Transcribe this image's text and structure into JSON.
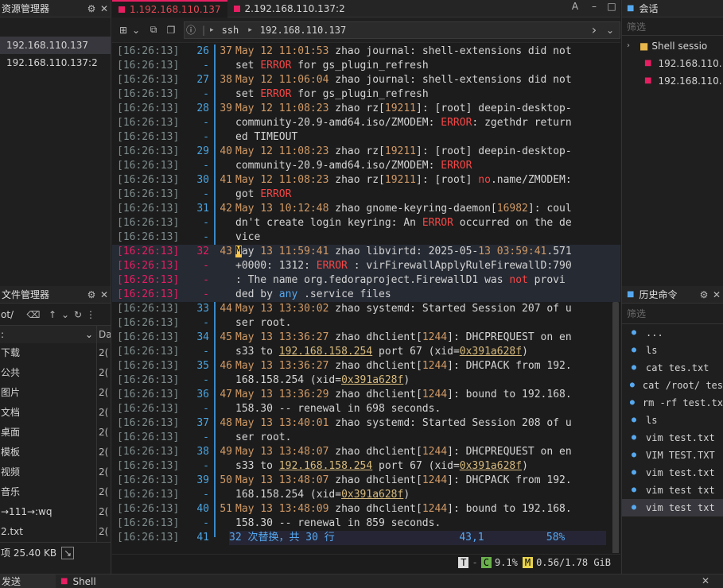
{
  "left": {
    "session_title": "资源管理器",
    "sessions": [
      "192.168.110.137",
      "192.168.110.137:2"
    ],
    "fm_title": "文件管理器",
    "fm_path": "ot/",
    "fm_col_date": "Da",
    "files": [
      {
        "name": "下载",
        "d": "2("
      },
      {
        "name": "公共",
        "d": "2("
      },
      {
        "name": "图片",
        "d": "2("
      },
      {
        "name": "文档",
        "d": "2("
      },
      {
        "name": "桌面",
        "d": "2("
      },
      {
        "name": "模板",
        "d": "2("
      },
      {
        "name": "视频",
        "d": "2("
      },
      {
        "name": "音乐",
        "d": "2("
      },
      {
        "name": "→111→:wq",
        "d": "2("
      },
      {
        "name": "2.txt",
        "d": "2("
      }
    ],
    "fm_status": "项 25.40 KB"
  },
  "tabs": [
    {
      "label": "1.192.168.110.137"
    },
    {
      "label": "2.192.168.110.137:2"
    }
  ],
  "tab_right": "A",
  "toolbar": {
    "path1": "ssh",
    "path2": "192.168.110.137"
  },
  "lines": [
    {
      "ts": "[16:26:13]",
      "ln": "26",
      "n": "37",
      "a": "May 12 11:01:53 zhao journal: shell-extensions did not",
      "b": "set ERROR for gs_plugin_refresh"
    },
    {
      "ts": "[16:26:13]",
      "ln": "27",
      "n": "38",
      "a": "May 12 11:06:04 zhao journal: shell-extensions did not",
      "b": "set ERROR for gs_plugin_refresh"
    },
    {
      "ts": "[16:26:13]",
      "ln": "28",
      "n": "39",
      "a": "May 12 11:08:23 zhao rz[19211]: [root] deepin-desktop-",
      "b": "community-20.9-amd64.iso/ZMODEM: ERROR: zgethdr return",
      "c": "ed TIMEOUT"
    },
    {
      "ts": "[16:26:13]",
      "ln": "29",
      "n": "40",
      "a": "May 12 11:08:23 zhao rz[19211]: [root] deepin-desktop-",
      "b": "community-20.9-amd64.iso/ZMODEM: ERROR"
    },
    {
      "ts": "[16:26:13]",
      "ln": "30",
      "n": "41",
      "a": "May 12 11:08:23 zhao rz[19211]: [root] no.name/ZMODEM:",
      "b": "got ERROR"
    },
    {
      "ts": "[16:26:13]",
      "ln": "31",
      "n": "42",
      "a": "May 13 10:12:48 zhao gnome-keyring-daemon[16982]: coul",
      "b": "dn't create login keyring: An ERROR occurred on the de",
      "c": "vice"
    },
    {
      "ts": "[16:26:13]",
      "ln": "32",
      "n": "43",
      "a": "May 13 11:59:41 zhao libvirtd: 2025-05-13 03:59:41.571",
      "b": "+0000: 1312: ERROR : virFirewallApplyRuleFirewallD:790",
      "c": ": The name org.fedoraproject.FirewallD1 was not provi",
      "d": "ded by any .service files"
    },
    {
      "ts": "[16:26:13]",
      "ln": "33",
      "n": "44",
      "a": "May 13 13:30:02 zhao systemd: Started Session 207 of u",
      "b": "ser root."
    },
    {
      "ts": "[16:26:13]",
      "ln": "34",
      "n": "45",
      "a": "May 13 13:36:27 zhao dhclient[1244]: DHCPREQUEST on en",
      "b": "s33 to 192.168.158.254 port 67 (xid=0x391a628f)"
    },
    {
      "ts": "[16:26:13]",
      "ln": "35",
      "n": "46",
      "a": "May 13 13:36:27 zhao dhclient[1244]: DHCPACK from 192.",
      "b": "168.158.254 (xid=0x391a628f)"
    },
    {
      "ts": "[16:26:13]",
      "ln": "36",
      "n": "47",
      "a": "May 13 13:36:29 zhao dhclient[1244]: bound to 192.168.",
      "b": "158.30 -- renewal in 698 seconds."
    },
    {
      "ts": "[16:26:13]",
      "ln": "37",
      "n": "48",
      "a": "May 13 13:40:01 zhao systemd: Started Session 208 of u",
      "b": "ser root."
    },
    {
      "ts": "[16:26:13]",
      "ln": "38",
      "n": "49",
      "a": "May 13 13:48:07 zhao dhclient[1244]: DHCPREQUEST on en",
      "b": "s33 to 192.168.158.254 port 67 (xid=0x391a628f)"
    },
    {
      "ts": "[16:26:13]",
      "ln": "39",
      "n": "50",
      "a": "May 13 13:48:07 zhao dhclient[1244]: DHCPACK from 192.",
      "b": "168.158.254 (xid=0x391a628f)"
    },
    {
      "ts": "[16:26:13]",
      "ln": "40",
      "n": "51",
      "a": "May 13 13:48:09 zhao dhclient[1244]: bound to 192.168.",
      "b": "158.30 -- renewal in 859 seconds."
    },
    {
      "ts": "[16:26:13]",
      "ln": "41",
      "n": "",
      "a": "32 次替换，共 30 行                    43,1          58%"
    }
  ],
  "status": {
    "t": "T",
    "c": "C",
    "cpu": "9.1%",
    "m": "M",
    "mem": "0.56/1.78 GiB"
  },
  "right": {
    "sess_title": "会话",
    "filter": "筛选",
    "folder": "Shell sessio",
    "items": [
      "192.168.110.",
      "192.168.110."
    ],
    "hist_title": "历史命令",
    "hist_filter": "筛选",
    "history": [
      "...",
      "ls",
      "cat tes.txt",
      "cat /root/ tes",
      "rm -rf test.tx",
      "ls",
      "vim test.txt",
      "VIM TEST.TXT",
      "vim test.txt",
      "vim test txt",
      "vim test txt"
    ]
  },
  "bottom_tabs": [
    "发送",
    "Shell"
  ]
}
